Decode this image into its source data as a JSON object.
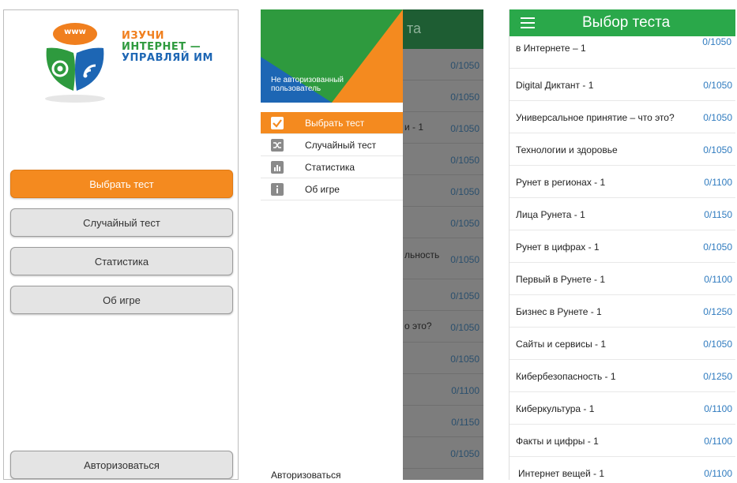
{
  "screen1": {
    "logo": {
      "badge": "www",
      "line1": "ИЗУЧИ",
      "line2": "ИНТЕРНЕТ —",
      "line3": "УПРАВЛЯЙ ИМ"
    },
    "buttons": [
      {
        "label": "Выбрать тест",
        "active": true
      },
      {
        "label": "Случайный тест",
        "active": false
      },
      {
        "label": "Статистика",
        "active": false
      },
      {
        "label": "Об игре",
        "active": false
      }
    ],
    "auth_label": "Авторизоваться"
  },
  "screen2": {
    "background": {
      "title_fragment": "та",
      "scores": [
        "0/1050",
        "0/1050",
        "0/1050",
        "0/1050",
        "0/1050",
        "0/1050",
        "0/1050",
        "0/1050",
        "0/1050",
        "0/1050",
        "0/1100",
        "0/1150",
        "0/1050"
      ],
      "label_fragments": {
        "r2": "и - 1",
        "r6": "льность",
        "r8": "о это?"
      }
    },
    "drawer": {
      "user_status": "Не авторизованный пользователь",
      "items": [
        {
          "label": "Выбрать тест",
          "icon": "check-icon",
          "active": true
        },
        {
          "label": "Случайный тест",
          "icon": "shuffle-icon",
          "active": false
        },
        {
          "label": "Статистика",
          "icon": "chart-icon",
          "active": false
        },
        {
          "label": "Об игре",
          "icon": "info-icon",
          "active": false
        }
      ],
      "auth_label": "Авторизоваться"
    }
  },
  "screen3": {
    "title": "Выбор теста",
    "partial_item": {
      "label": "в Интернете – 1",
      "score": "0/1050"
    },
    "items": [
      {
        "label": "Digital Диктант - 1",
        "score": "0/1050"
      },
      {
        "label": "Универсальное принятие – что это?",
        "score": "0/1050"
      },
      {
        "label": "Технологии и здоровье",
        "score": "0/1050"
      },
      {
        "label": "Рунет в регионах - 1",
        "score": "0/1100"
      },
      {
        "label": "Лица Рунета - 1",
        "score": "0/1150"
      },
      {
        "label": "Рунет в цифрах - 1",
        "score": "0/1050"
      },
      {
        "label": "Первый в Рунете - 1",
        "score": "0/1100"
      },
      {
        "label": "Бизнес в Рунете - 1",
        "score": "0/1250"
      },
      {
        "label": "Сайты и сервисы - 1",
        "score": "0/1050"
      },
      {
        "label": "Кибербезопасность - 1",
        "score": "0/1250"
      },
      {
        "label": "Киберкультура - 1",
        "score": "0/1100"
      },
      {
        "label": "Факты и цифры - 1",
        "score": "0/1100"
      },
      {
        "label": "Интернет вещей - 1",
        "score": "0/1100"
      }
    ]
  },
  "colors": {
    "orange": "#f48a1f",
    "green": "#2aa84a",
    "blue": "#1d66b4",
    "score_blue": "#2f7bbf"
  }
}
